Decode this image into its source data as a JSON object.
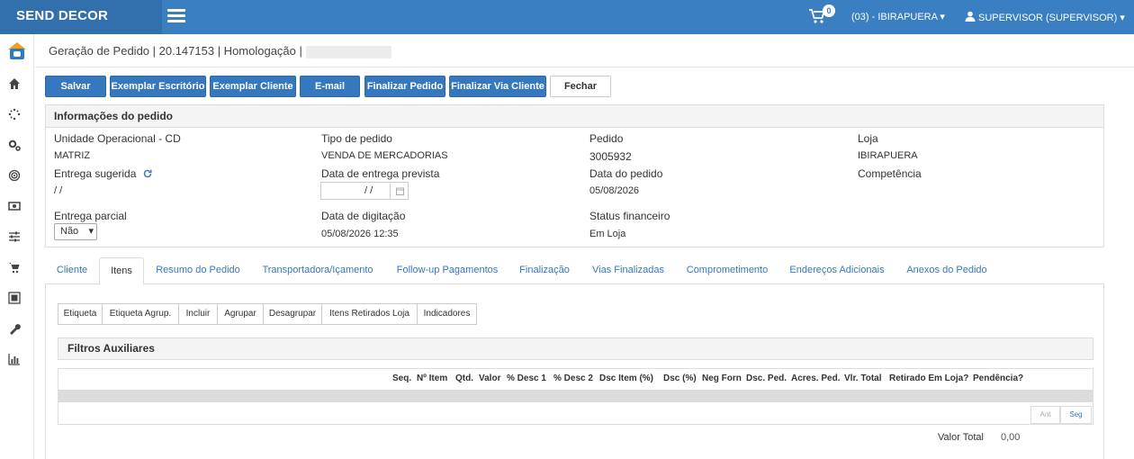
{
  "app": {
    "brand": "SEND DECOR",
    "cart_count": "0",
    "store": "(03) - IBIRAPUERA",
    "user": "SUPERVISOR (SUPERVISOR)"
  },
  "breadcrumb": "Geração de Pedido | 20.147153 | Homologação |",
  "toolbar": {
    "save": "Salvar",
    "office_copy": "Exemplar Escritório",
    "client_copy": "Exemplar Cliente",
    "email": "E-mail",
    "finalize": "Finalizar Pedido",
    "finalize_client": "Finalizar Via Cliente",
    "close": "Fechar"
  },
  "order_info": {
    "title": "Informações do pedido",
    "unit_label": "Unidade Operacional - CD",
    "unit_value": "MATRIZ",
    "type_label": "Tipo de pedido",
    "type_value": "VENDA DE MERCADORIAS",
    "order_label": "Pedido",
    "order_value": "3005932",
    "store_label": "Loja",
    "store_value": "IBIRAPUERA",
    "suggested_label": "Entrega sugerida",
    "suggested_value": "/ /",
    "expected_label": "Data de entrega prevista",
    "expected_value": "/ /",
    "order_date_label": "Data do pedido",
    "order_date_value": "05/08/2026",
    "competence_label": "Competência",
    "partial_label": "Entrega parcial",
    "partial_value": "Não",
    "typing_date_label": "Data de digitação",
    "typing_date_value": "05/08/2026 12:35",
    "financial_label": "Status financeiro",
    "financial_value": "Em Loja"
  },
  "tabs": [
    "Cliente",
    "Itens",
    "Resumo do Pedido",
    "Transportadora/Içamento",
    "Follow-up Pagamentos",
    "Finalização",
    "Vias Finalizadas",
    "Comprometimento",
    "Endereços Adicionais",
    "Anexos do Pedido"
  ],
  "subtoolbar": [
    "Etiqueta",
    "Etiqueta Agrup.",
    "Incluir",
    "Agrupar",
    "Desagrupar",
    "Itens Retirados Loja",
    "Indicadores"
  ],
  "filters_title": "Filtros Auxiliares",
  "grid_columns": [
    "Seq.",
    "Nº Item",
    "Qtd.",
    "Valor",
    "% Desc 1",
    "% Desc 2",
    "Dsc Item (%)",
    "Dsc (%)",
    "Neg Forn",
    "Dsc. Ped.",
    "Acres. Ped.",
    "Vlr. Total",
    "Retirado Em Loja?",
    "Pendência?"
  ],
  "pager": {
    "prev": "Ant",
    "next": "Seg"
  },
  "total": {
    "label": "Valor Total",
    "value": "0,00"
  },
  "colors": {
    "primary": "#3a7fc1",
    "button": "#3578bd",
    "link": "#3578bd"
  }
}
